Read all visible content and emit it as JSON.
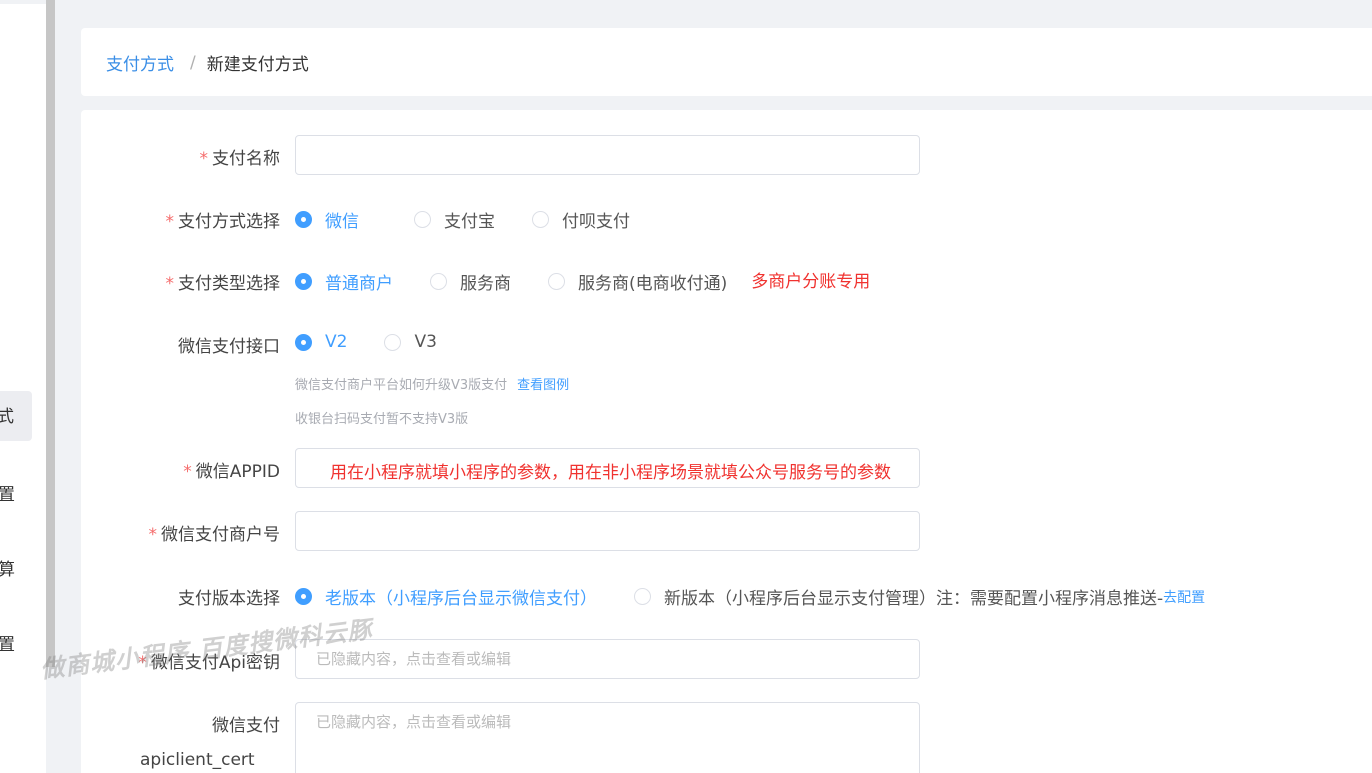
{
  "sidebar": {
    "items": [
      {
        "label": "式"
      },
      {
        "label": "置"
      },
      {
        "label": "算"
      },
      {
        "label": "置"
      }
    ]
  },
  "breadcrumb": {
    "root": "支付方式",
    "separator": "/",
    "current": "新建支付方式"
  },
  "form": {
    "pay_name": {
      "label": "支付名称",
      "required": "*",
      "value": ""
    },
    "pay_method": {
      "label": "支付方式选择",
      "required": "*",
      "options": [
        "微信",
        "支付宝",
        "付呗支付"
      ],
      "selected": "微信"
    },
    "pay_type": {
      "label": "支付类型选择",
      "required": "*",
      "options": [
        "普通商户",
        "服务商",
        "服务商(电商收付通)"
      ],
      "selected": "普通商户",
      "note": "多商户分账专用"
    },
    "wx_api": {
      "label": "微信支付接口",
      "options": [
        "V2",
        "V3"
      ],
      "selected": "V2",
      "hint1": "微信支付商户平台如何升级V3版支付",
      "hint1_link": "查看图例",
      "hint2": "收银台扫码支付暂不支持V3版"
    },
    "wx_appid": {
      "label": "微信APPID",
      "required": "*",
      "overlay_note": "用在小程序就填小程序的参数，用在非小程序场景就填公众号服务号的参数"
    },
    "wx_mchid": {
      "label": "微信支付商户号",
      "required": "*"
    },
    "pay_version": {
      "label": "支付版本选择",
      "options": [
        "老版本（小程序后台显示微信支付）",
        "新版本（小程序后台显示支付管理）"
      ],
      "selected": "老版本（小程序后台显示微信支付）",
      "note": "注：需要配置小程序消息推送-",
      "note_link": "去配置"
    },
    "api_key": {
      "label": "微信支付Api密钥",
      "required": "*",
      "placeholder": "已隐藏内容，点击查看或编辑"
    },
    "cert": {
      "label": "微信支付",
      "label_cut": "apiclient_cert",
      "placeholder": "已隐藏内容，点击查看或编辑"
    }
  },
  "watermark": "做商城小程序 百度搜微科云豚",
  "colors": {
    "primary": "#409eff",
    "required": "#f56c6c",
    "note": "#f0322f"
  }
}
